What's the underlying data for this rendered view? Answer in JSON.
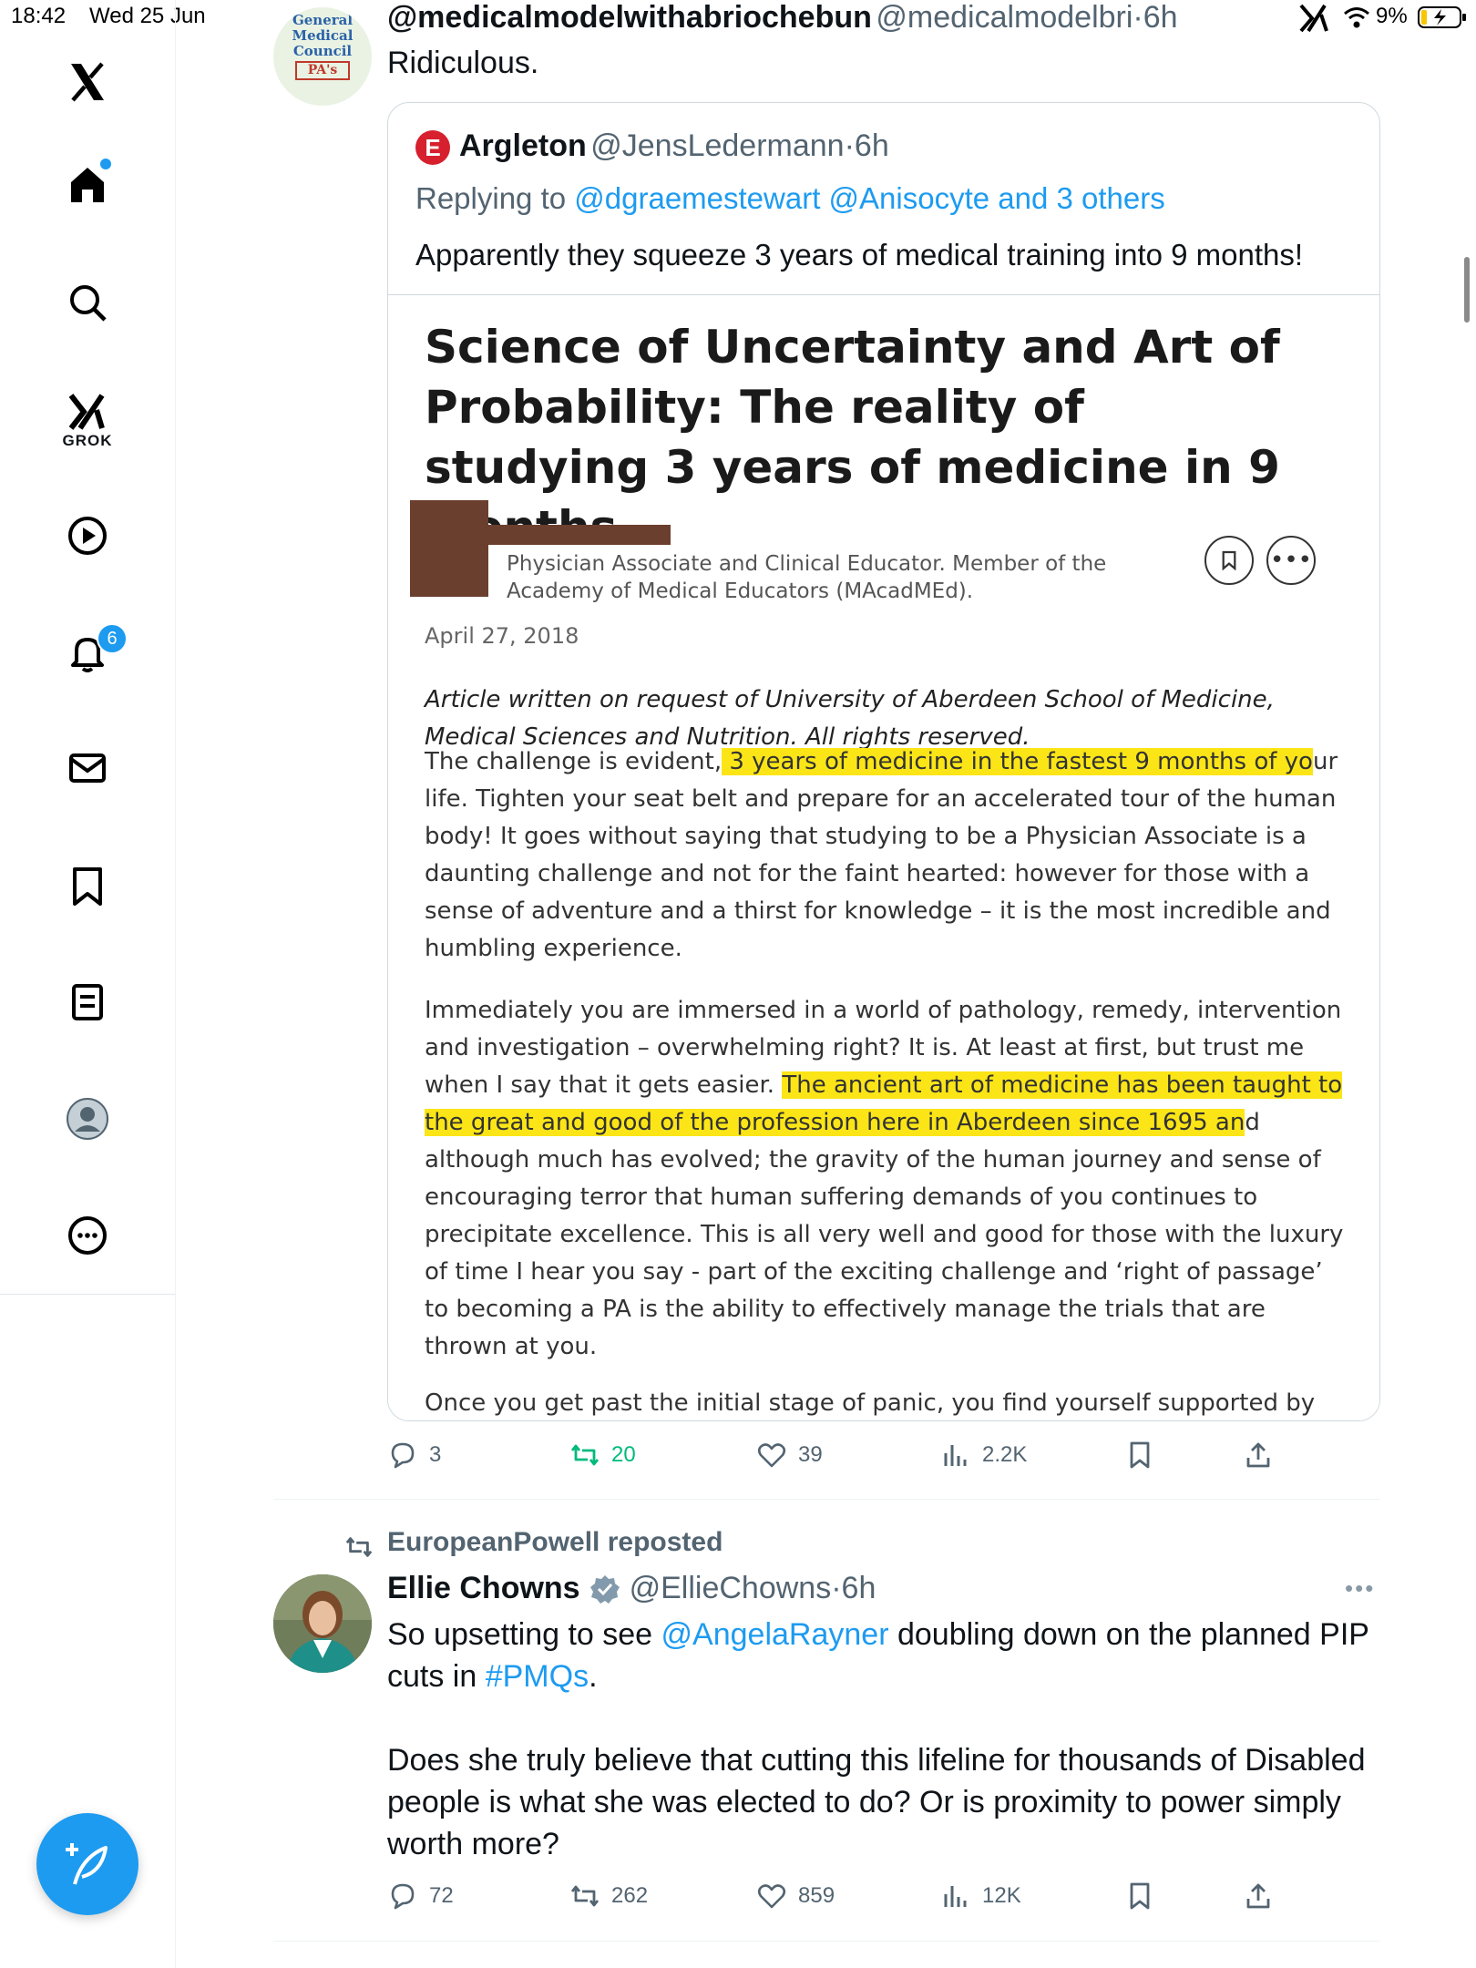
{
  "status_bar": {
    "time": "18:42",
    "date": "Wed 25 Jun",
    "battery": "9%"
  },
  "sidebar": {
    "grok_label": "GROK",
    "notifications_badge": "6"
  },
  "tweet1": {
    "display_name": "@medicalmodelwithabriochebun",
    "handle": "@medicalmodelbri",
    "time": "6h",
    "text": "Ridiculous.",
    "avatar_text": [
      "General",
      "Medical",
      "Council",
      "PA's"
    ],
    "quote": {
      "display_name": "Argleton",
      "handle": "@JensLedermann",
      "time": "6h",
      "replying_prefix": "Replying to ",
      "replying_to": "@dgraemestewart @Anisocyte and 3 others",
      "text": "Apparently they squeeze 3 years of medical training into 9 months!",
      "article": {
        "title": "Science of Uncertainty and Art of Probability: The reality of studying 3 years of medicine in 9 months.",
        "author_bio": "Physician Associate and Clinical Educator. Member of the Academy of Medical Educators (MAcadMEd).",
        "date": "April 27, 2018",
        "intro": "Article written on request of University of Aberdeen School of Medicine, Medical Sciences and Nutrition. All rights reserved.",
        "p1_a": "The challenge is evident,",
        "p1_hl": " 3 years of medicine in the fastest 9 months of yo",
        "p1_b": "ur life.  Tighten your seat belt and prepare for an accelerated tour of the human body!  It goes without saying that studying to be a Physician Associate is a daunting challenge and not for the faint hearted: however for those with a sense of adventure and a thirst for knowledge – it is the most incredible and humbling experience.",
        "p2_a": "Immediately you are immersed in a world of pathology, remedy, intervention and investigation – overwhelming right? It is. At least at first, but trust me when I say that it gets easier. ",
        "p2_hl": "The ancient art of medicine has been taught to the great and good of the profession here in Aberdeen since 1695 an",
        "p2_b": "d although much has evolved; the gravity of the human journey and sense of encouraging terror that human suffering demands of you continues to precipitate excellence.  This is all very well and good for those with the luxury of time I hear you say - part of the exciting challenge and ‘right of passage’ to becoming a PA is the ability to effectively manage the trials that are thrown at you.",
        "p3": "Once you get past the initial stage of panic, you find yourself supported by an"
      }
    },
    "actions": {
      "replies": "3",
      "reposts": "20",
      "likes": "39",
      "views": "2.2K"
    }
  },
  "tweet2": {
    "reposted_by": "EuropeanPowell reposted",
    "display_name": "Ellie Chowns",
    "handle": "@EllieChowns",
    "time": "6h",
    "text_a": "So upsetting to see ",
    "mention": "@AngelaRayner",
    "text_b": " doubling down on the planned PIP cuts in ",
    "hashtag": "#PMQs",
    "text_c": ".",
    "text2": "Does she truly believe that cutting this lifeline for thousands of Disabled people is what she was elected to do? Or is proximity to power simply worth more?",
    "actions": {
      "replies": "72",
      "reposts": "262",
      "likes": "859",
      "views": "12K"
    }
  },
  "colors": {
    "accent": "#1d9bf0",
    "repost_active": "#00ba7c",
    "highlight": "#fbe517"
  }
}
